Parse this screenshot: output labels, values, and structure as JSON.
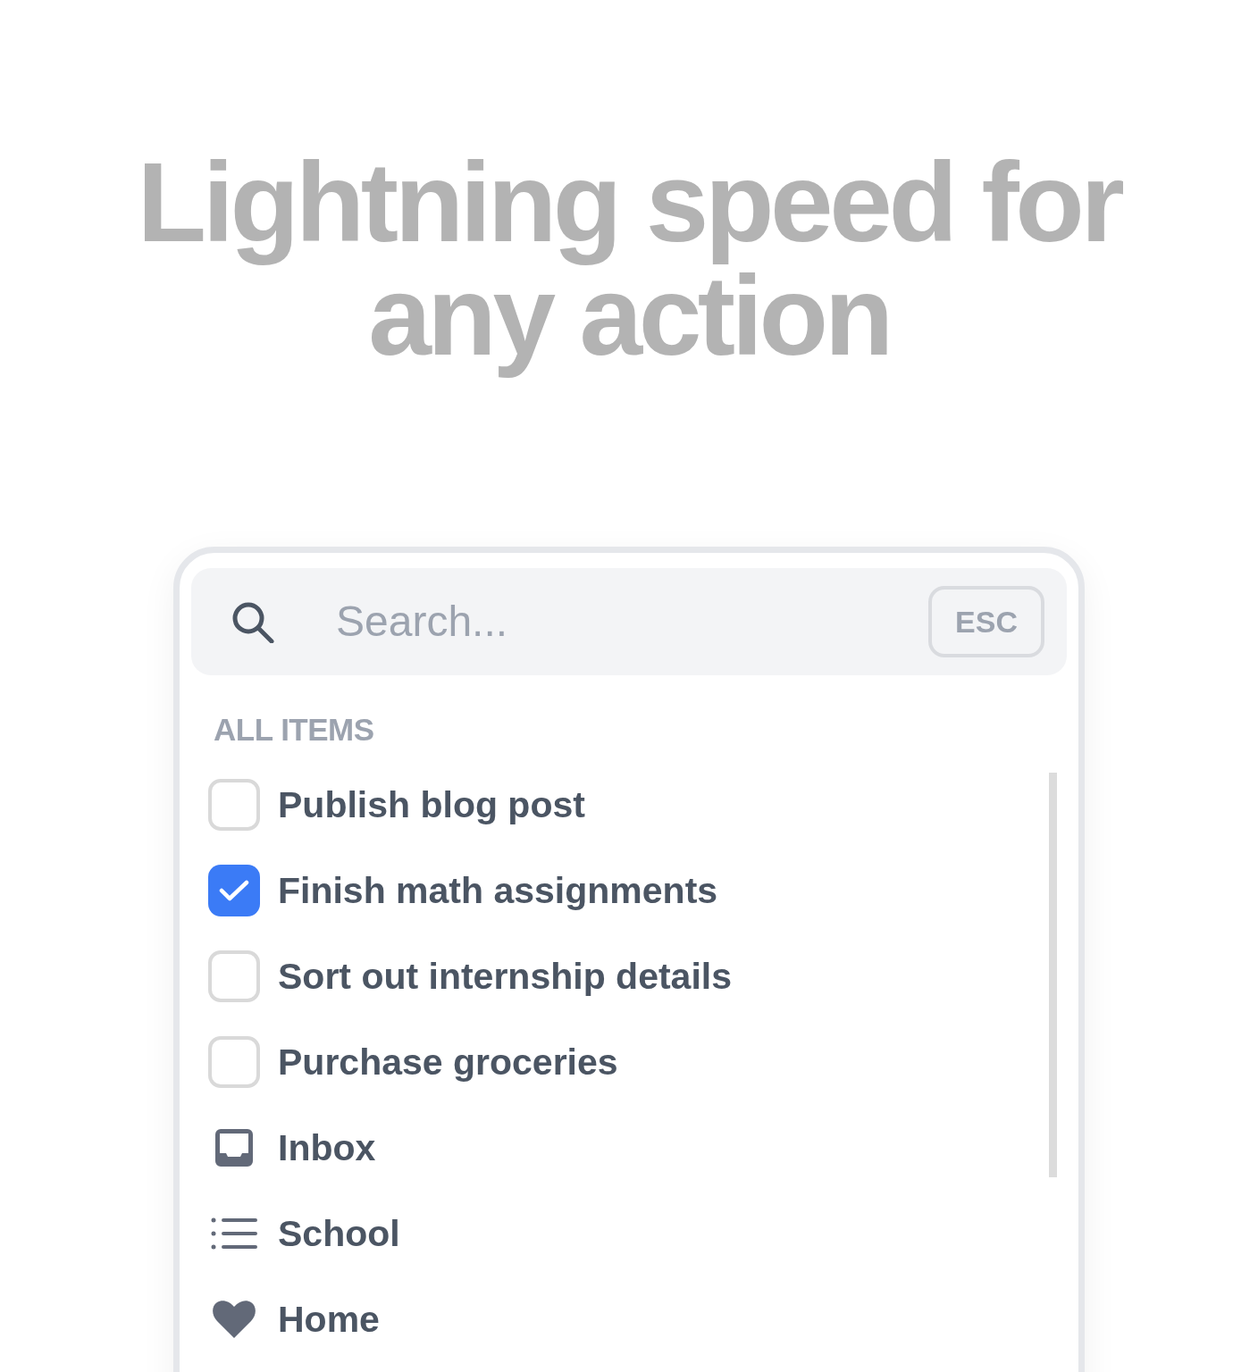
{
  "headline": "Lightning speed for any action",
  "search": {
    "placeholder": "Search...",
    "shortcut": "ESC"
  },
  "list": {
    "heading": "ALL ITEMS",
    "tasks": [
      {
        "label": "Publish blog post",
        "checked": false
      },
      {
        "label": "Finish math assignments",
        "checked": true
      },
      {
        "label": "Sort out internship details",
        "checked": false
      },
      {
        "label": "Purchase groceries",
        "checked": false
      }
    ],
    "collections": [
      {
        "kind": "inbox",
        "label": "Inbox"
      },
      {
        "kind": "list",
        "label": "School"
      },
      {
        "kind": "favorite",
        "label": "Home"
      }
    ]
  }
}
